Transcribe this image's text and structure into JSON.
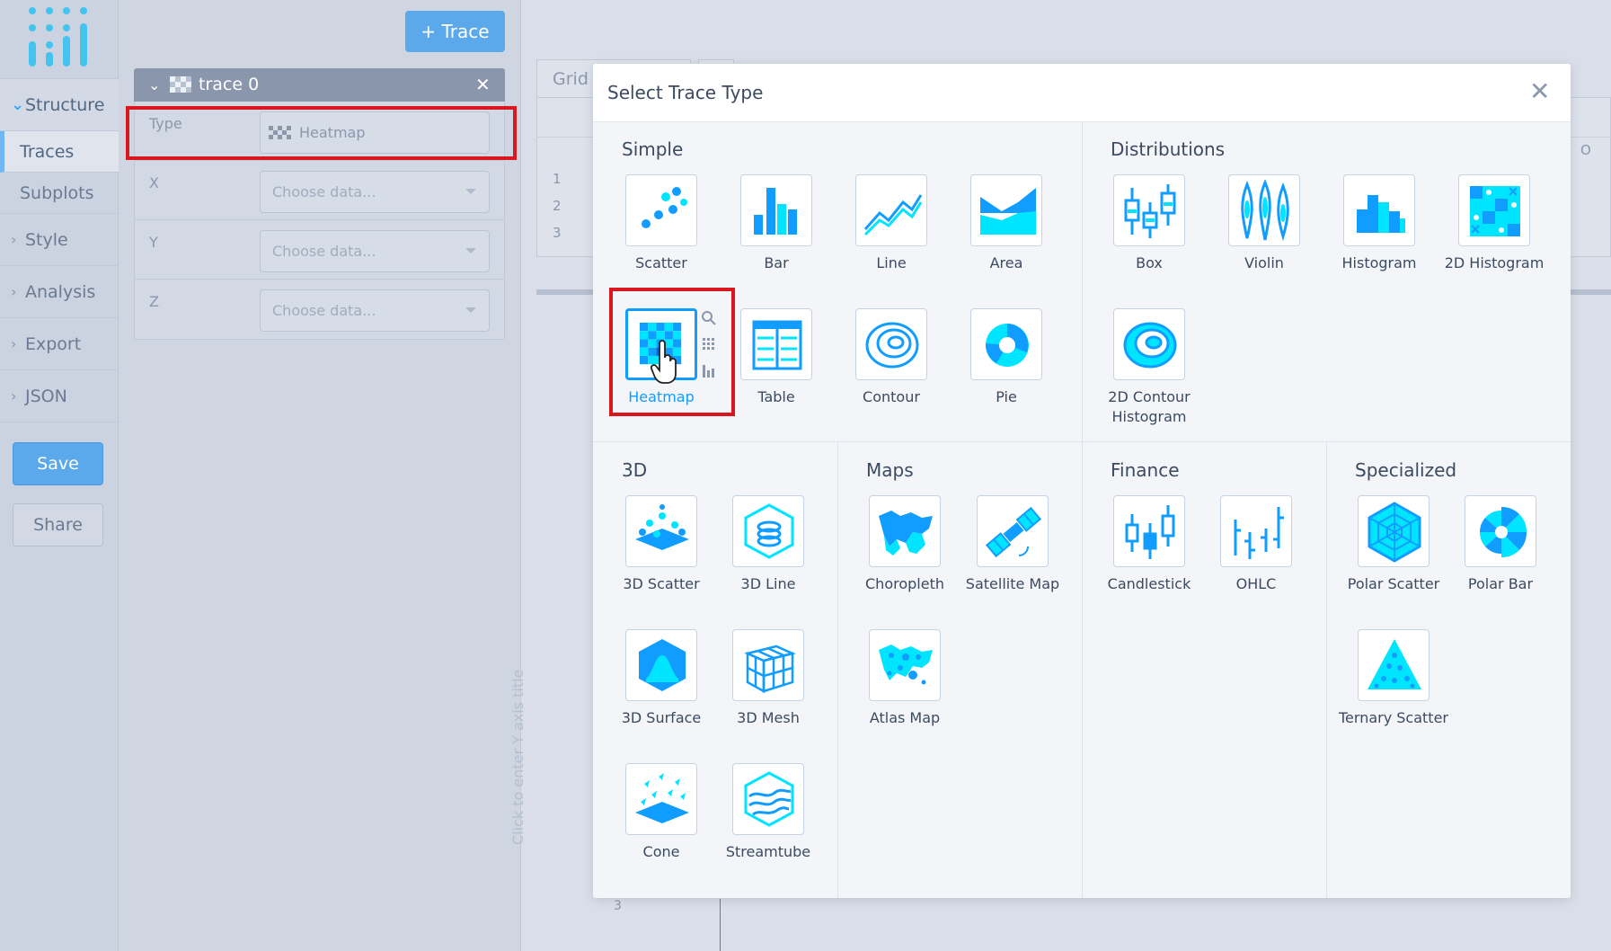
{
  "sidebar": {
    "section": "Structure",
    "sub_items": [
      "Traces",
      "Subplots"
    ],
    "nav_items": [
      "Style",
      "Analysis",
      "Export",
      "JSON"
    ],
    "save_label": "Save",
    "share_label": "Share"
  },
  "panel": {
    "add_trace_label": "+ Trace",
    "trace_name": "trace 0",
    "rows": [
      {
        "label": "Type",
        "value": "Heatmap"
      },
      {
        "label": "X",
        "value": "Choose data..."
      },
      {
        "label": "Y",
        "value": "Choose data..."
      },
      {
        "label": "Z",
        "value": "Choose data..."
      }
    ]
  },
  "background": {
    "grid_tab": "Grid",
    "row_numbers": [
      "1",
      "2",
      "3"
    ],
    "col_letter": "O",
    "y_axis_placeholder": "Click to enter Y axis title",
    "y_tick": "3"
  },
  "modal": {
    "title": "Select Trace Type",
    "sections": {
      "simple": "Simple",
      "distributions": "Distributions",
      "three_d": "3D",
      "maps": "Maps",
      "finance": "Finance",
      "specialized": "Specialized"
    },
    "items": {
      "scatter": "Scatter",
      "bar": "Bar",
      "line": "Line",
      "area": "Area",
      "heatmap": "Heatmap",
      "table": "Table",
      "contour": "Contour",
      "pie": "Pie",
      "box": "Box",
      "violin": "Violin",
      "histogram": "Histogram",
      "histogram2d": "2D Histogram",
      "contour2d_histogram": "2D Contour Histogram",
      "scatter3d": "3D Scatter",
      "line3d": "3D Line",
      "surface3d": "3D Surface",
      "mesh3d": "3D Mesh",
      "cone": "Cone",
      "streamtube": "Streamtube",
      "choropleth": "Choropleth",
      "satellite_map": "Satellite Map",
      "atlas_map": "Atlas Map",
      "candlestick": "Candlestick",
      "ohlc": "OHLC",
      "polar_scatter": "Polar Scatter",
      "polar_bar": "Polar Bar",
      "ternary_scatter": "Ternary Scatter"
    }
  },
  "colors": {
    "accent": "#119dff",
    "icon_light": "#00e5ff",
    "highlight": "#d9171f",
    "button": "#5ba9eb"
  }
}
